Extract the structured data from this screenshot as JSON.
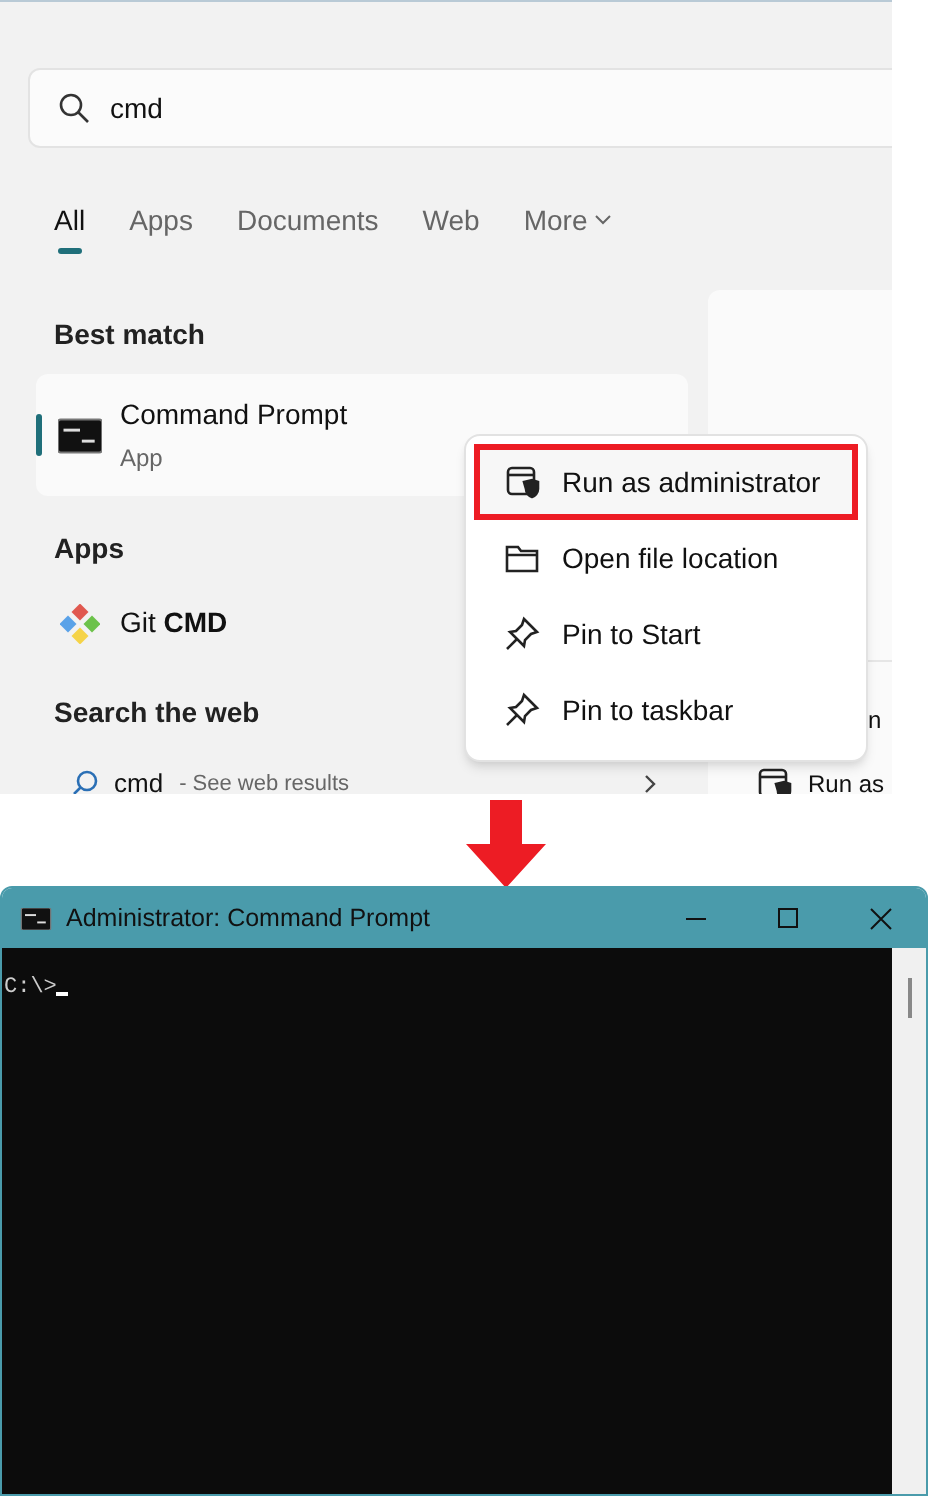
{
  "search": {
    "value": "cmd"
  },
  "tabs": [
    {
      "label": "All",
      "selected": true,
      "kind": "tab"
    },
    {
      "label": "Apps",
      "selected": false,
      "kind": "tab"
    },
    {
      "label": "Documents",
      "selected": false,
      "kind": "tab"
    },
    {
      "label": "Web",
      "selected": false,
      "kind": "tab"
    },
    {
      "label": "More",
      "selected": false,
      "kind": "menu"
    }
  ],
  "best_match": {
    "heading": "Best match",
    "name": "Command Prompt",
    "type": "App",
    "selected": true
  },
  "apps": {
    "heading": "Apps",
    "items": [
      {
        "label": "Git **CMD**"
      }
    ]
  },
  "web": {
    "heading": "Search the web",
    "items": [
      {
        "query": "cmd",
        "hint": "- See web results"
      }
    ]
  },
  "preview": {
    "texts": [
      "n"
    ],
    "actions": [
      {
        "label": "Run as"
      }
    ]
  },
  "context_menu": [
    {
      "label": "Run as administrator",
      "kind": "shield",
      "highlighted": true
    },
    {
      "label": "Open file location",
      "kind": "folder",
      "highlighted": false
    },
    {
      "label": "Pin to Start",
      "kind": "pin",
      "highlighted": false
    },
    {
      "label": "Pin to taskbar",
      "kind": "pin",
      "highlighted": false
    }
  ],
  "terminal": {
    "title": "Administrator: Command Prompt",
    "prompt": "C:\\>"
  }
}
